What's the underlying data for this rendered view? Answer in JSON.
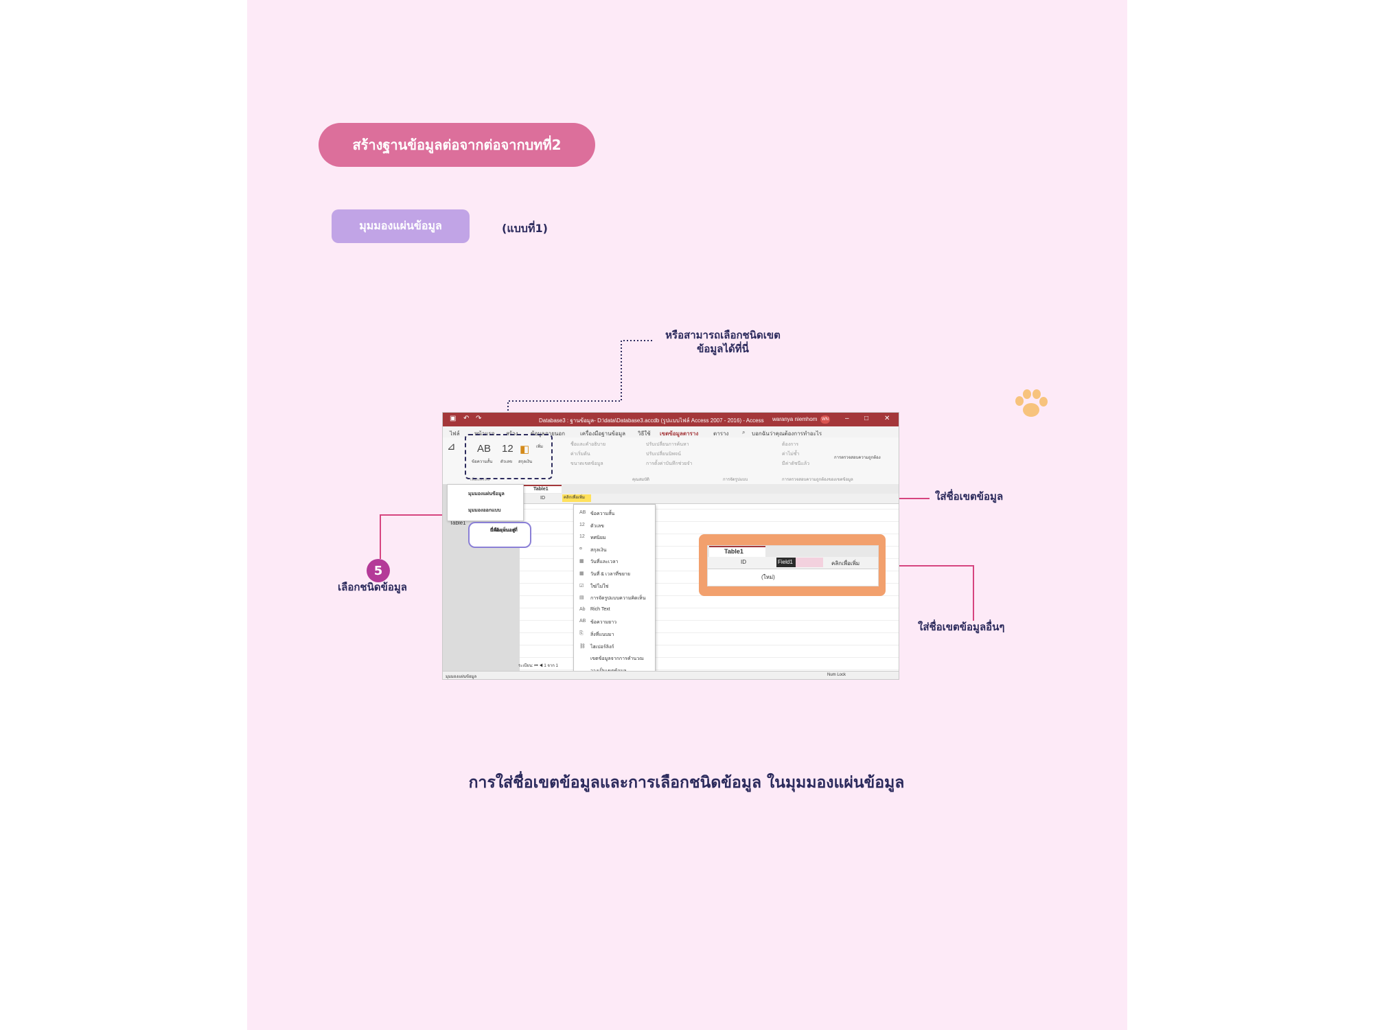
{
  "header": {
    "title": "สร้างฐานข้อมูลต่อจากต่อจากบทที่2",
    "view_label": "มุมมองแผ่นข้อมูล",
    "variant": "(แบบที่1)"
  },
  "annotations": {
    "top": "หรือสามารถเลือกชนิดเขต ข้อมูลได้ที่นี่",
    "top_line1": "หรือสามารถเลือกชนิดเขต",
    "top_line2": "ข้อมูลได้ที่นี่",
    "field_name": "ใส่ชื่อเขตข้อมูล",
    "other_field": "ใส่ชื่อเขตข้อมูลอื่นๆ",
    "step_number": "5",
    "choose_type": "เลือกชนิดข้อมูล",
    "view_callout_line1": "นี่คือมุมมองที่",
    "view_callout_line2": "กำลังเห็นอยู่"
  },
  "caption": "การใส่ชื่อเขตข้อมูลและการเลือกชนิดข้อมูล ในมุมมองแผ่นข้อมูล",
  "access": {
    "title": "Database3 : ฐานข้อมูล- D:\\data\\Database3.accdb (รูปแบบไฟล์ Access 2007 - 2016) - Access",
    "user": "waranya niemhom",
    "user_initials": "WN",
    "menu": [
      "ไฟล์",
      "หน้าแรก",
      "สร้าง",
      "ข้อมูลภายนอก",
      "เครื่องมือฐานข้อมูล",
      "วิธีใช้",
      "เขตข้อมูลตาราง",
      "ตาราง",
      "บอกฉันว่าคุณต้องการทำอะไร"
    ],
    "active_menu": "เขตข้อมูลตาราง",
    "ribbon": {
      "view": "มุมมอง",
      "short_text_icon": "AB",
      "short_text": "ข้อความสั้น",
      "number_icon": "12",
      "number": "ตัวเลข",
      "currency": "สกุลเงิน",
      "more": "เพิ่ม",
      "group_add_delete": "เพิ่มและลบ",
      "group_properties": "คุณสมบัติ",
      "group_format": "การจัดรูปแบบ",
      "group_validation": "การตรวจสอบความถูกต้องของเขตข้อมูล",
      "name_caption": "ชื่อและคำอธิบาย",
      "default_value": "ค่าเริ่มต้น",
      "field_size": "ขนาดเขตข้อมูล",
      "modify_lookups": "ปรับเปลี่ยนการค้นหา",
      "modify_expression": "ปรับเปลี่ยนนิพจน์",
      "memo_settings": "การตั้งค่าบันทึกช่วยจำ",
      "required": "ต้องการ",
      "unique": "ค่าไม่ซ้ำ",
      "indexed": "มีค่าดัชนีแล้ว",
      "validation": "การตรวจสอบความถูกต้อง"
    },
    "view_menu": [
      "มุมมองแผ่นข้อมูล",
      "มุมมองออกแบบ"
    ],
    "nav_item": "Table1",
    "tab": "Table1",
    "col_id": "ID",
    "col_add": "คลิกเพื่อเพิ่ม",
    "new_row": "(ใหม่)",
    "type_menu": [
      {
        "icon": "AB",
        "label": "ข้อความสั้น"
      },
      {
        "icon": "12",
        "label": "ตัวเลข"
      },
      {
        "icon": "12",
        "label": "ทศนิยม"
      },
      {
        "icon": "¤",
        "label": "สกุลเงิน"
      },
      {
        "icon": "▦",
        "label": "วันที่และเวลา"
      },
      {
        "icon": "▦",
        "label": "วันที่ & เวลาที่ขยาย"
      },
      {
        "icon": "☑",
        "label": "ใช่/ไม่ใช่"
      },
      {
        "icon": "▤",
        "label": "การจัดรูปแบบความคิดเห็น"
      },
      {
        "icon": "Ab",
        "label": "Rich Text"
      },
      {
        "icon": "AB",
        "label": "ข้อความยาว"
      },
      {
        "icon": "⎘",
        "label": "สิ่งที่แนบมา"
      },
      {
        "icon": "⛓",
        "label": "ไฮเปอร์ลิงก์"
      },
      {
        "icon": "",
        "label": "เขตข้อมูลจากการคำนวณ"
      },
      {
        "icon": "",
        "label": "วางเป็นเขตข้อมูล"
      }
    ],
    "record_nav": "ระเบียน: ⏮ ◀ 1 จาก 1",
    "status_left": "มุมมองแผ่นข้อมูล",
    "status_right": "Num Lock"
  },
  "inset": {
    "tab": "Table1",
    "col_id": "ID",
    "field": "Field1",
    "col_add": "คลิกเพื่อเพิ่ม",
    "new_row": "(ใหม่)"
  },
  "colors": {
    "title_pill": "#dc6f9b",
    "view_pill": "#c1a4e6",
    "slide_bg": "#fdeaf7",
    "access_red": "#a4373a",
    "accent_pink": "#d6447f",
    "inset_orange": "#f2a06d",
    "step_badge": "#b43a98"
  }
}
